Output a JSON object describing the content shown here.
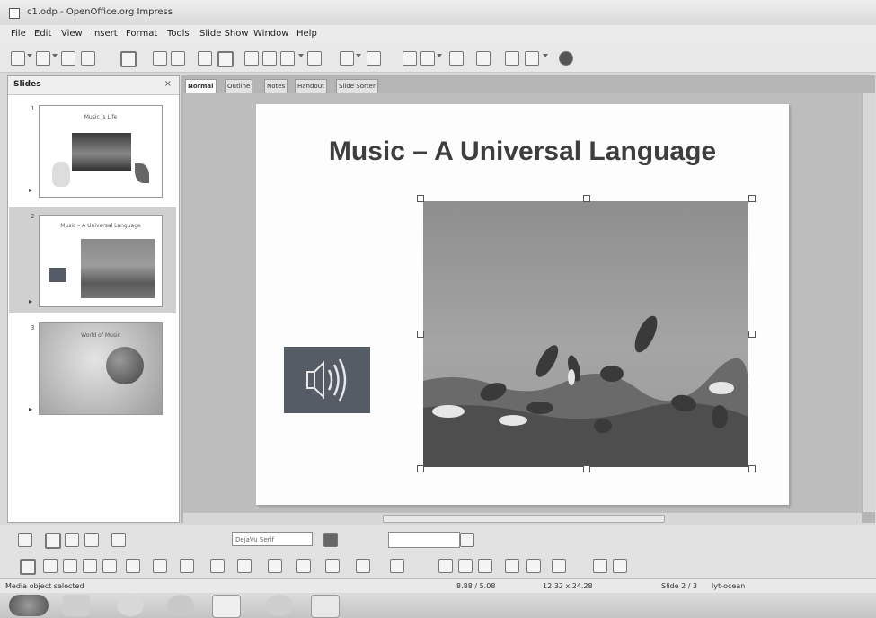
{
  "window": {
    "title": "c1.odp - OpenOffice.org Impress"
  },
  "menu": [
    "File",
    "Edit",
    "View",
    "Insert",
    "Format",
    "Tools",
    "Slide Show",
    "Window",
    "Help"
  ],
  "slides_pane": {
    "title": "Slides",
    "close": "×",
    "thumbnails": [
      {
        "number": "1",
        "title": "Music is Life"
      },
      {
        "number": "2",
        "title": "Music – A Universal Language"
      },
      {
        "number": "3",
        "title": "World of Music"
      }
    ]
  },
  "view_tabs": [
    "Normal",
    "Outline",
    "Notes",
    "Handout",
    "Slide Sorter"
  ],
  "slide": {
    "title": "Music – A Universal Language"
  },
  "formatting": {
    "font_name": "DejaVu Serif"
  },
  "status": {
    "selection": "Media object selected",
    "position": "8.88 / 5.08",
    "size": "12.32 x 24.28",
    "slide": "Slide 2 / 3",
    "layout": "lyt-ocean"
  },
  "icons": [
    "save-icon",
    "print-icon",
    "undo-icon",
    "help-icon",
    "speaker-icon",
    "globe-icon"
  ]
}
